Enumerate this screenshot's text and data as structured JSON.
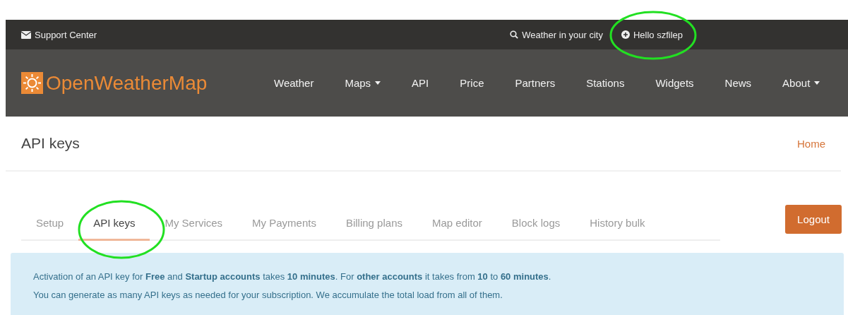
{
  "top_bar": {
    "support": "Support Center",
    "search": "Weather in your city",
    "user": "Hello szfilep"
  },
  "navbar": {
    "logo": "OpenWeatherMap",
    "items": [
      {
        "label": "Weather",
        "dropdown": false
      },
      {
        "label": "Maps",
        "dropdown": true
      },
      {
        "label": "API",
        "dropdown": false
      },
      {
        "label": "Price",
        "dropdown": false
      },
      {
        "label": "Partners",
        "dropdown": false
      },
      {
        "label": "Stations",
        "dropdown": false
      },
      {
        "label": "Widgets",
        "dropdown": false
      },
      {
        "label": "News",
        "dropdown": false
      },
      {
        "label": "About",
        "dropdown": true
      }
    ]
  },
  "page_header": {
    "title": "API keys",
    "breadcrumb": "Home"
  },
  "tabs": [
    {
      "label": "Setup",
      "selected": false
    },
    {
      "label": "API keys",
      "selected": true
    },
    {
      "label": "My Services",
      "selected": false
    },
    {
      "label": "My Payments",
      "selected": false
    },
    {
      "label": "Billing plans",
      "selected": false
    },
    {
      "label": "Map editor",
      "selected": false
    },
    {
      "label": "Block logs",
      "selected": false
    },
    {
      "label": "History bulk",
      "selected": false
    }
  ],
  "logout_button": "Logout",
  "info_alert": [
    "Activation of an API key for **Free** and **Startup accounts** takes **10 minutes**. For **other accounts** it takes from **10** to **60 minutes**.",
    "You can generate as many API keys as needed for your subscription. We accumulate the total load from all of them."
  ]
}
